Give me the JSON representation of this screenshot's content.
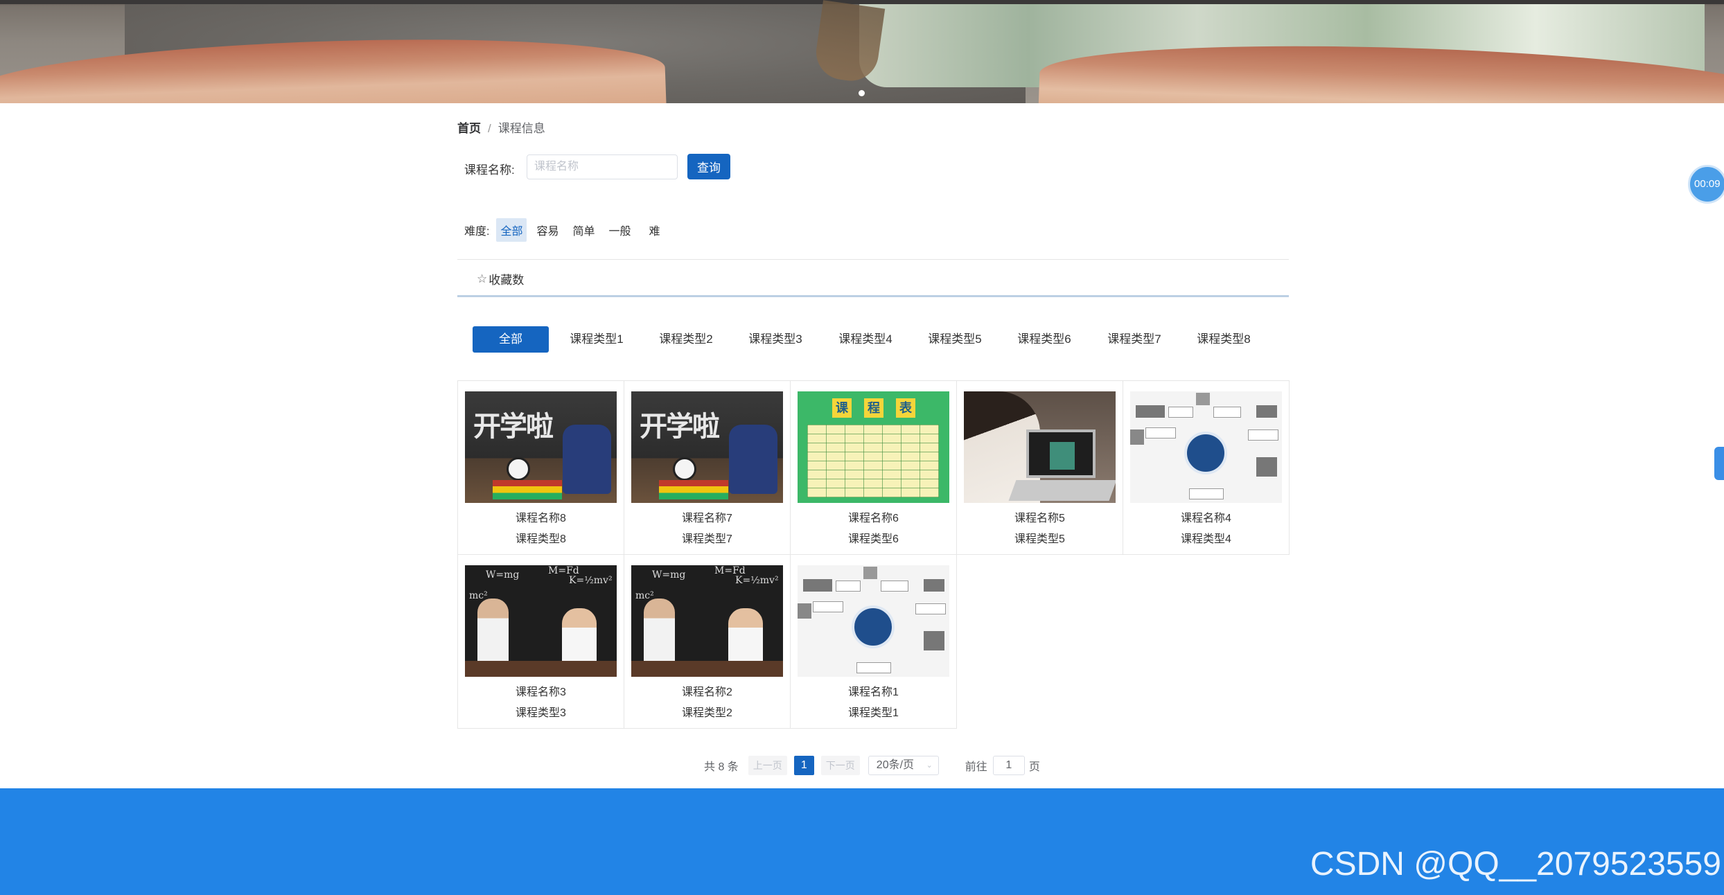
{
  "breadcrumb": {
    "home": "首页",
    "separator": "/",
    "current": "课程信息"
  },
  "search": {
    "label": "课程名称:",
    "placeholder": "课程名称",
    "button": "查询"
  },
  "difficulty": {
    "label": "难度:",
    "options": [
      "全部",
      "容易",
      "简单",
      "一般",
      "难"
    ],
    "selected": "全部"
  },
  "sort": {
    "label": "收藏数",
    "icon": "star-outline-icon"
  },
  "type_tabs": [
    "全部",
    "课程类型1",
    "课程类型2",
    "课程类型3",
    "课程类型4",
    "课程类型5",
    "课程类型6",
    "课程类型7",
    "课程类型8"
  ],
  "type_tab_selected": "全部",
  "courses": [
    {
      "name": "课程名称8",
      "type": "课程类型8",
      "image": "school-chalkboard"
    },
    {
      "name": "课程名称7",
      "type": "课程类型7",
      "image": "school-chalkboard"
    },
    {
      "name": "课程名称6",
      "type": "课程类型6",
      "image": "timetable"
    },
    {
      "name": "课程名称5",
      "type": "课程类型5",
      "image": "laptop-study"
    },
    {
      "name": "课程名称4",
      "type": "课程类型4",
      "image": "mind-map"
    },
    {
      "name": "课程名称3",
      "type": "课程类型3",
      "image": "physics-kids"
    },
    {
      "name": "课程名称2",
      "type": "课程类型2",
      "image": "physics-kids"
    },
    {
      "name": "课程名称1",
      "type": "课程类型1",
      "image": "mind-map"
    }
  ],
  "thumb_text": {
    "chalk": "开学啦",
    "schedule": [
      "课",
      "程",
      "表"
    ],
    "formulas": [
      "W=mg",
      "K=½mv²",
      "M=Fd",
      "mc²"
    ]
  },
  "pagination": {
    "total": "共 8 条",
    "prev": "上一页",
    "current_page": "1",
    "next": "下一页",
    "page_size": "20条/页",
    "goto_label": "前往",
    "goto_value": "1",
    "goto_unit": "页"
  },
  "timer": "00:09",
  "watermark": "CSDN @QQ__2079523559",
  "colors": {
    "primary": "#1565c0",
    "footer": "#2284e6",
    "active_filter_bg": "#dbe7f5"
  }
}
